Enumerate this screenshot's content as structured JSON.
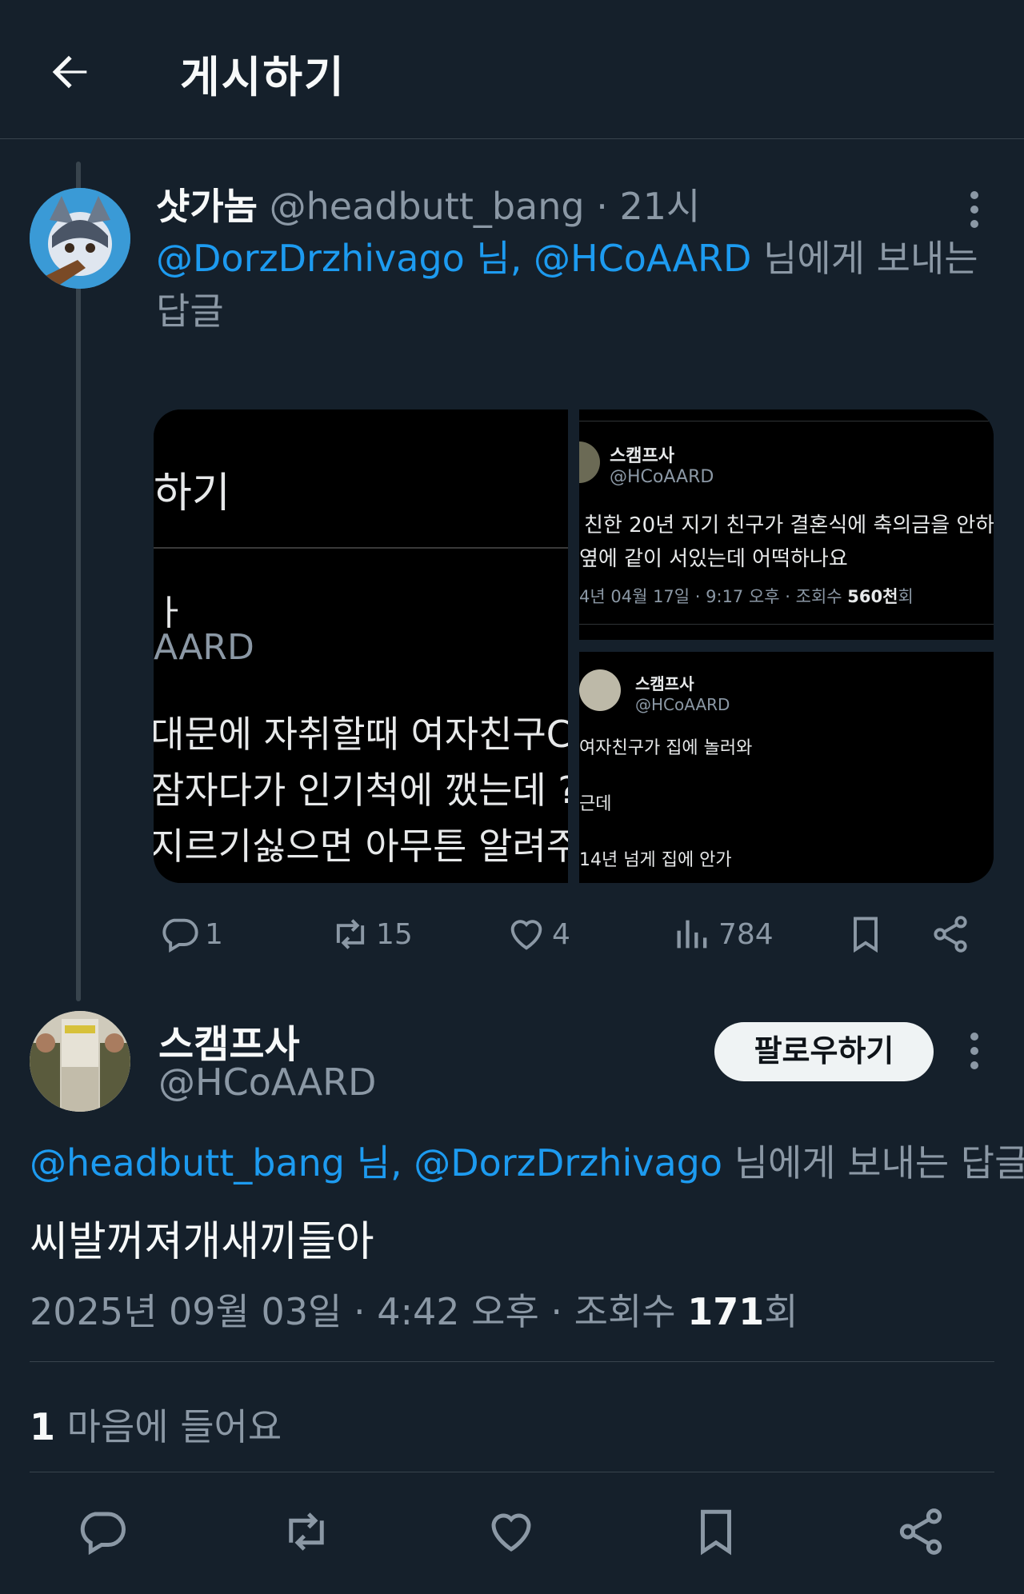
{
  "header": {
    "title": "게시하기",
    "back_icon": "arrow-left-icon"
  },
  "reply_tweet": {
    "display_name": "샷가놈",
    "handle": "@headbutt_bang",
    "time": "· 21시",
    "reply_mention_1": "@DorzDrzhivago 님,",
    "reply_mention_2": "@HCoAARD",
    "reply_suffix_1": " 님에게 보내는",
    "reply_suffix_2": "답글",
    "media": {
      "left": {
        "title": "하기",
        "name": "ㅏ",
        "handle": "AARD",
        "lines": [
          "대문에 자취할때 여자친구C",
          "잠자다가 인기척에 깼는데 ?",
          "지르기싫으면 아무튼 알려주"
        ]
      },
      "right_top": {
        "name": "스캠프사",
        "handle": "@HCoAARD",
        "lines": [
          "친한 20년 지기 친구가 결혼식에 축의금을 안하",
          "옆에 같이 서있는데 어떡하나요"
        ],
        "meta_prefix": "4년 04월 17일 · 9:17 오후 · 조회수 ",
        "meta_views": "560천",
        "meta_suffix": "회"
      },
      "right_bottom": {
        "name": "스캠프사",
        "handle": "@HCoAARD",
        "lines": [
          "여자친구가 집에 놀러와",
          "근데",
          "14년 넘게 집에 안가"
        ]
      }
    },
    "actions": {
      "replies": "1",
      "retweets": "15",
      "likes": "4",
      "views": "784"
    }
  },
  "main_tweet": {
    "display_name": "스캠프사",
    "handle": "@HCoAARD",
    "follow_label": "팔로우하기",
    "reply_mention_1": "@headbutt_bang 님,",
    "reply_mention_2": "@DorzDrzhivago",
    "reply_suffix": " 님에게 보내는 답글",
    "text": "씨발꺼져개새끼들아",
    "meta_prefix": "2025년 09월 03일 · 4:42 오후 · 조회수 ",
    "meta_views": "171",
    "meta_suffix": "회",
    "likes_count": "1",
    "likes_label": " 마음에 들어요"
  },
  "colors": {
    "background": "#15202b",
    "accent": "#1d9bf0",
    "secondary_text": "#8b98a5"
  }
}
